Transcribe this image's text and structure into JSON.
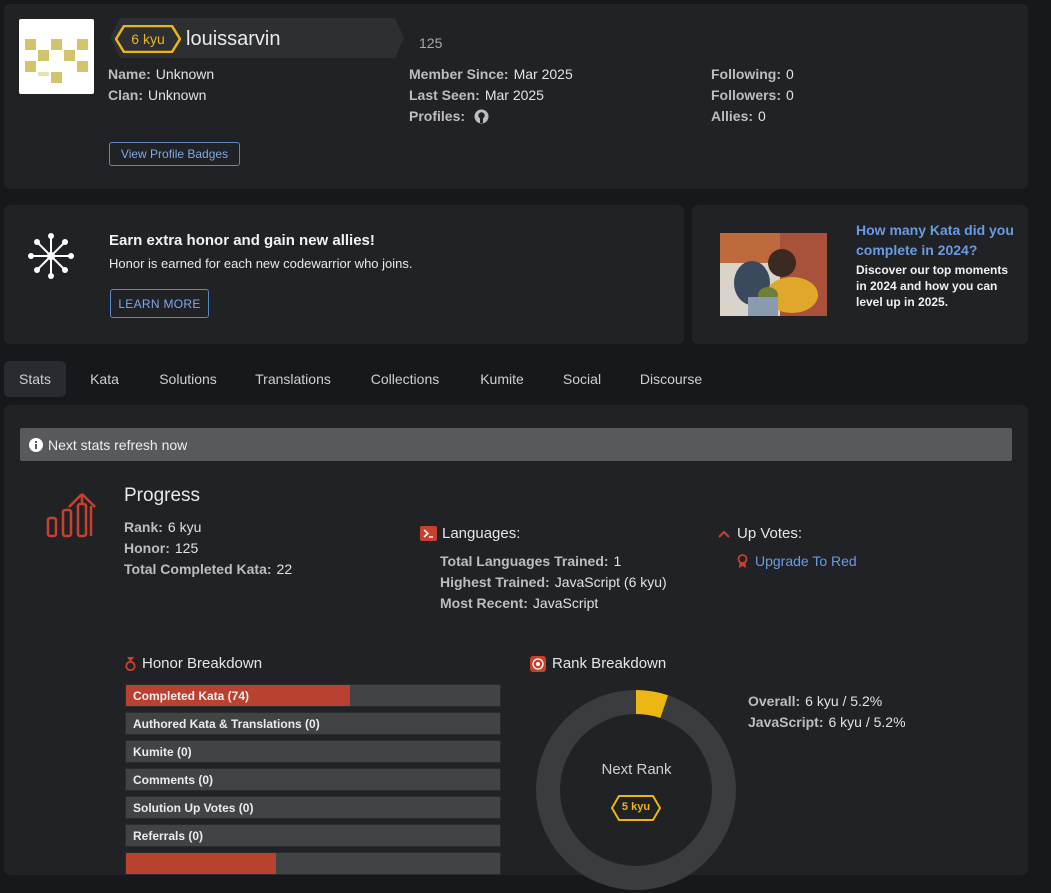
{
  "profile": {
    "rank_badge": "6 kyu",
    "username": "louissarvin",
    "honor": "125",
    "name_label": "Name:",
    "name_value": "Unknown",
    "clan_label": "Clan:",
    "clan_value": "Unknown",
    "member_since_label": "Member Since:",
    "member_since_value": "Mar 2025",
    "last_seen_label": "Last Seen:",
    "last_seen_value": "Mar 2025",
    "profiles_label": "Profiles:",
    "following_label": "Following:",
    "following_value": "0",
    "followers_label": "Followers:",
    "followers_value": "0",
    "allies_label": "Allies:",
    "allies_value": "0",
    "badges_button": "View Profile Badges"
  },
  "promo": {
    "title": "Earn extra honor and gain new allies!",
    "subtitle": "Honor is earned for each new codewarrior who joins.",
    "button": "LEARN MORE"
  },
  "promo2": {
    "link1": "How many Kata did you",
    "link2": "complete in 2024?",
    "line1": "Discover our top moments",
    "line2": "in 2024 and how you can",
    "line3": "level up in 2025."
  },
  "tabs": [
    "Stats",
    "Kata",
    "Solutions",
    "Translations",
    "Collections",
    "Kumite",
    "Social",
    "Discourse"
  ],
  "stats": {
    "refresh": "Next stats refresh now",
    "progress_title": "Progress",
    "rank_label": "Rank:",
    "rank_value": "6 kyu",
    "honor_label": "Honor:",
    "honor_value": "125",
    "total_label": "Total Completed Kata:",
    "total_value": "22",
    "languages_title": "Languages:",
    "lang_trained_label": "Total Languages Trained:",
    "lang_trained_value": "1",
    "highest_label": "Highest Trained:",
    "highest_value": "JavaScript (6 kyu)",
    "recent_label": "Most Recent:",
    "recent_value": "JavaScript",
    "upvotes_title": "Up Votes:",
    "upgrade_link": "Upgrade To Red"
  },
  "honor_breakdown": {
    "title": "Honor Breakdown",
    "bars": [
      {
        "label": "Completed Kata (74)",
        "fill": 0.6
      },
      {
        "label": "Authored Kata & Translations (0)",
        "fill": 0
      },
      {
        "label": "Kumite (0)",
        "fill": 0
      },
      {
        "label": "Comments (0)",
        "fill": 0
      },
      {
        "label": "Solution Up Votes (0)",
        "fill": 0
      },
      {
        "label": "Referrals (0)",
        "fill": 0
      },
      {
        "label": "",
        "fill": 0.4
      }
    ]
  },
  "rank_breakdown": {
    "title": "Rank Breakdown",
    "progress": 0.052,
    "center_label": "Next Rank",
    "next_rank": "5 kyu",
    "overall_label": "Overall:",
    "overall_value": "6 kyu / 5.2%",
    "js_label": "JavaScript:",
    "js_value": "6 kyu / 5.2%"
  },
  "colors": {
    "accent": "#ecb613",
    "red": "#b9412f",
    "link": "#6a9be2"
  }
}
